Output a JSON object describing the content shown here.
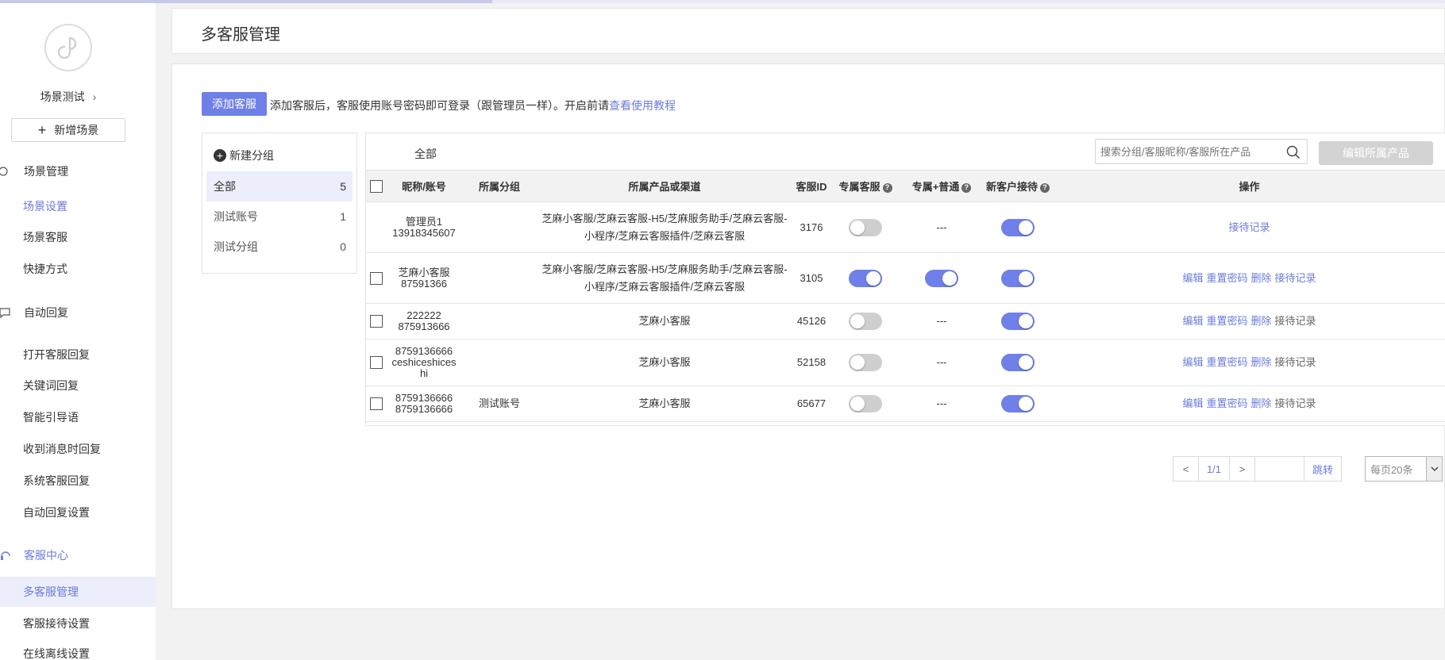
{
  "sidebar": {
    "scene_name": "场景测试",
    "add_scene": "新增场景",
    "groups": [
      {
        "label": "场景管理",
        "items": [
          "场景设置",
          "场景客服",
          "快捷方式"
        ]
      },
      {
        "label": "自动回复",
        "items": [
          "打开客服回复",
          "关键词回复",
          "智能引导语",
          "收到消息时回复",
          "系统客服回复",
          "自动回复设置"
        ]
      },
      {
        "label": "客服中心",
        "items": [
          "多客服管理",
          "客服接待设置",
          "在线离线设置"
        ]
      }
    ]
  },
  "header": {
    "title": "多客服管理"
  },
  "toolbar": {
    "add_button": "添加客服",
    "tip_text": "添加客服后，客服使用账号密码即可登录（跟管理员一样）。开启前请",
    "tip_link": "查看使用教程"
  },
  "groups_panel": {
    "new_group": "新建分组",
    "rows": [
      {
        "name": "全部",
        "count": "5"
      },
      {
        "name": "测试账号",
        "count": "1"
      },
      {
        "name": "测试分组",
        "count": "0"
      }
    ]
  },
  "table_panel": {
    "title": "全部",
    "search_placeholder": "搜索分组/客服昵称/客服所在产品",
    "edit_product": "编辑所属产品",
    "columns": [
      "昵称/账号",
      "所属分组",
      "所属产品或渠道",
      "客服ID",
      "专属客服",
      "专属+普通",
      "新客户接待",
      "操作"
    ],
    "rows": [
      {
        "name": "管理员1",
        "account": "13918345607",
        "group": "",
        "product": "芝麻小客服/芝麻云客服-H5/芝麻服务助手/芝麻云客服-小程序/芝麻云客服插件/芝麻云客服",
        "id": "3176",
        "exclusive": false,
        "exclusive_normal": "---",
        "new_customer": true,
        "actions": [
          "接待记录"
        ]
      },
      {
        "name": "芝麻小客服",
        "account": "87591366",
        "group": "",
        "product": "芝麻小客服/芝麻云客服-H5/芝麻服务助手/芝麻云客服-小程序/芝麻云客服插件/芝麻云客服",
        "id": "3105",
        "exclusive": true,
        "exclusive_normal": "on",
        "new_customer": true,
        "actions": [
          "编辑",
          "重置密码",
          "删除",
          "接待记录"
        ]
      },
      {
        "name": "222222",
        "account": "875913666",
        "group": "",
        "product": "芝麻小客服",
        "id": "45126",
        "exclusive": false,
        "exclusive_normal": "---",
        "new_customer": true,
        "actions": [
          "编辑",
          "重置密码",
          "删除",
          "接待记录"
        ]
      },
      {
        "name": "8759136666",
        "account": "ceshiceshicesh i",
        "account_lines": [
          "ceshiceshices",
          "hi"
        ],
        "group": "",
        "product": "芝麻小客服",
        "id": "52158",
        "exclusive": false,
        "exclusive_normal": "---",
        "new_customer": true,
        "actions": [
          "编辑",
          "重置密码",
          "删除",
          "接待记录"
        ]
      },
      {
        "name": "8759136666",
        "account": "8759136666",
        "group": "测试账号",
        "product": "芝麻小客服",
        "id": "65677",
        "exclusive": false,
        "exclusive_normal": "---",
        "new_customer": true,
        "actions": [
          "编辑",
          "重置密码",
          "删除",
          "接待记录"
        ]
      }
    ]
  },
  "pagination": {
    "prev": "<",
    "page": "1/1",
    "next": ">",
    "jump": "跳转",
    "per_page": "每页20条"
  },
  "colors": {
    "accent": "#6f80e8",
    "link": "#6b7bdb",
    "selected_bg": "#eceefc"
  }
}
